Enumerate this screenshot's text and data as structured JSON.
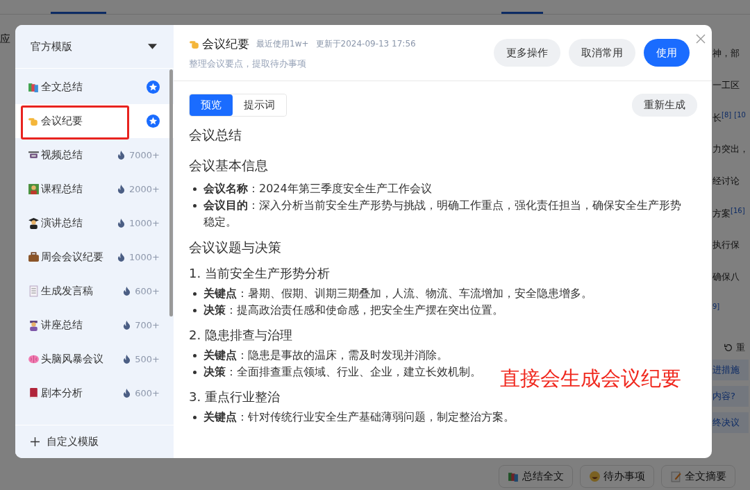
{
  "background": {
    "side_label": "应",
    "fragments": [
      "神，部",
      "一工区",
      "长$^{[8]}$ $^{[10}$",
      "力突出，",
      "经讨论",
      "方案$^{[16]}$",
      "执行保",
      "确保八",
      "$^{9]}$"
    ],
    "regenerate": "重",
    "questions": [
      "进措施",
      "内容?",
      "终决议"
    ],
    "bottom_buttons": [
      "总结全文",
      "待办事项",
      "全文摘要"
    ]
  },
  "dialog": {
    "sidebar": {
      "dropdown": "官方模版",
      "items": [
        {
          "label": "全文总结",
          "selected": false,
          "outlined": false,
          "badge": {
            "kind": "star"
          }
        },
        {
          "label": "会议纪要",
          "selected": true,
          "outlined": true,
          "badge": {
            "kind": "star"
          }
        },
        {
          "label": "视频总结",
          "selected": false,
          "outlined": false,
          "badge": {
            "kind": "hot",
            "count": "7000+"
          }
        },
        {
          "label": "课程总结",
          "selected": false,
          "outlined": false,
          "badge": {
            "kind": "hot",
            "count": "2000+"
          }
        },
        {
          "label": "演讲总结",
          "selected": false,
          "outlined": false,
          "badge": {
            "kind": "hot",
            "count": "1000+"
          }
        },
        {
          "label": "周会会议纪要",
          "selected": false,
          "outlined": false,
          "badge": {
            "kind": "hot",
            "count": "1000+"
          }
        },
        {
          "label": "生成发言稿",
          "selected": false,
          "outlined": false,
          "badge": {
            "kind": "hot",
            "count": "600+"
          }
        },
        {
          "label": "讲座总结",
          "selected": false,
          "outlined": false,
          "badge": {
            "kind": "hot",
            "count": "700+"
          }
        },
        {
          "label": "头脑风暴会议",
          "selected": false,
          "outlined": false,
          "badge": {
            "kind": "hot",
            "count": "500+"
          }
        },
        {
          "label": "剧本分析",
          "selected": false,
          "outlined": false,
          "badge": {
            "kind": "hot",
            "count": "600+"
          }
        }
      ],
      "add_button": "自定义模版"
    },
    "title": "会议纪要",
    "usage": "最近使用1w+",
    "updated": "更新于2024-09-13 17:56",
    "description": "整理会议要点，提取待办事项",
    "actions": [
      {
        "label": "更多操作",
        "primary": false
      },
      {
        "label": "取消常用",
        "primary": false
      },
      {
        "label": "使用",
        "primary": true
      }
    ],
    "tabs": [
      {
        "label": "预览",
        "selected": true
      },
      {
        "label": "提示词",
        "selected": false
      }
    ],
    "regenerate": "重新生成",
    "content": [
      {
        "kind": "title",
        "text": "会议总结"
      },
      {
        "kind": "heading",
        "text": "会议基本信息"
      },
      {
        "kind": "bullets",
        "items": [
          "**会议名称**：2024年第三季度安全生产工作会议",
          "**会议目的**：深入分析当前安全生产形势与挑战，明确工作重点，强化责任担当，确保安全生产形势稳定。"
        ]
      },
      {
        "kind": "heading",
        "text": "会议议题与决策"
      },
      {
        "kind": "subheading",
        "text": "1. 当前安全生产形势分析"
      },
      {
        "kind": "bullets",
        "items": [
          "**关键点**：暑期、假期、训期三期叠加，人流、物流、车流增加，安全隐患增多。",
          "**决策**：提高政治责任感和使命感，把安全生产摆在突出位置。"
        ]
      },
      {
        "kind": "subheading",
        "text": "2. 隐患排查与治理"
      },
      {
        "kind": "bullets",
        "items": [
          "**关键点**：隐患是事故的温床，需及时发现并消除。",
          "**决策**：全面排查重点领域、行业、企业，建立长效机制。"
        ]
      },
      {
        "kind": "subheading",
        "text": "3. 重点行业整治"
      },
      {
        "kind": "bullets",
        "items": [
          "**关键点**：针对传统行业安全生产基础薄弱问题，制定整治方案。"
        ]
      }
    ],
    "annotation": "直接会生成会议纪要"
  }
}
